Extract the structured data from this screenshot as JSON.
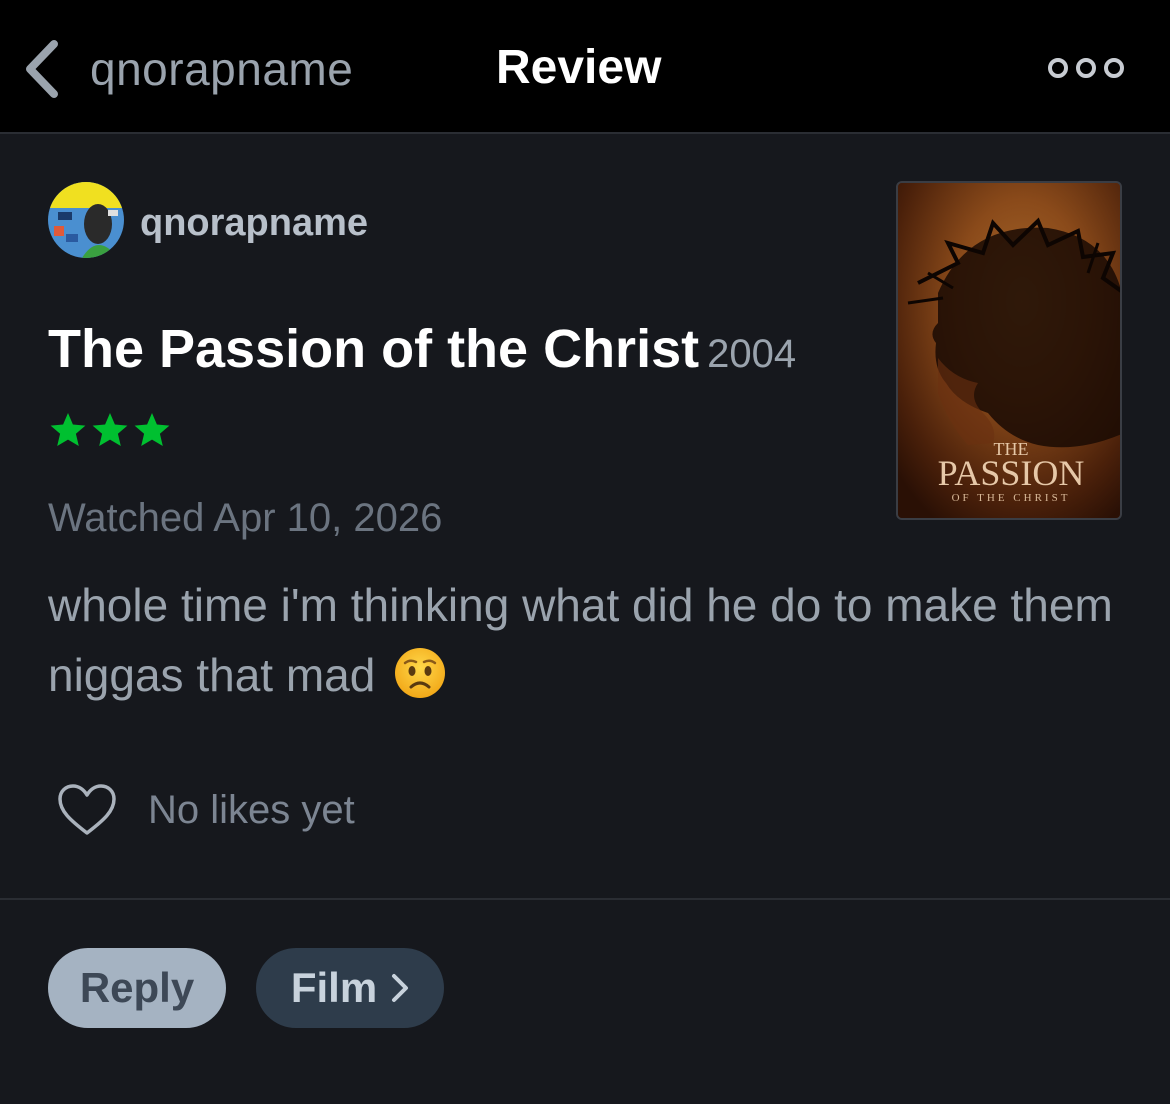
{
  "nav": {
    "back_label": "qnorapname",
    "title": "Review"
  },
  "review": {
    "username": "qnorapname",
    "film_title": "The Passion of the Christ",
    "year": "2004",
    "rating_stars": 3,
    "star_color": "#00c030",
    "watched": "Watched Apr 10, 2026",
    "text": "whole time i'm thinking what did he do to make them niggas that mad",
    "emoji": "worried-face"
  },
  "poster": {
    "line1": "THE",
    "line2": "PASSION",
    "line3": "OF THE CHRIST"
  },
  "likes": {
    "label": "No likes yet"
  },
  "actions": {
    "reply_label": "Reply",
    "film_label": "Film"
  }
}
